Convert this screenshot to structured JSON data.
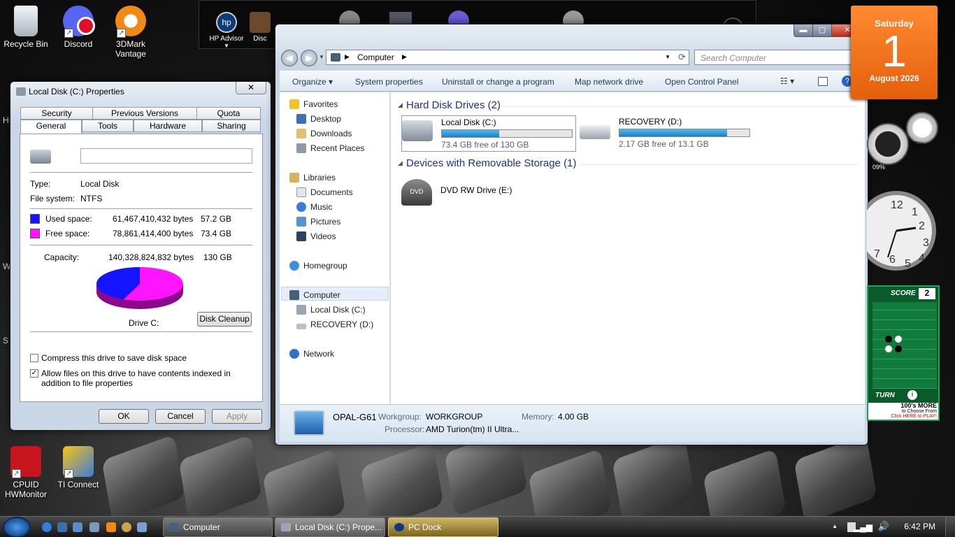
{
  "desktop": {
    "icons": [
      {
        "label": "Recycle Bin"
      },
      {
        "label": "Discord"
      },
      {
        "label": "3DMark Vantage"
      },
      {
        "label": "CPUID HWMonitor"
      },
      {
        "label": "TI Connect"
      }
    ],
    "edge_letters": [
      "H",
      "W",
      "S"
    ]
  },
  "dock": {
    "items": [
      {
        "label": "HP Advisor"
      },
      {
        "label": "Disc"
      }
    ]
  },
  "properties": {
    "title": "Local Disk (C:) Properties",
    "close": "✕",
    "tabs_row1": [
      "Security",
      "Previous Versions",
      "Quota"
    ],
    "tabs_row2": [
      "General",
      "Tools",
      "Hardware",
      "Sharing"
    ],
    "name_value": "",
    "type_label": "Type:",
    "type_value": "Local Disk",
    "fs_label": "File system:",
    "fs_value": "NTFS",
    "used_label": "Used space:",
    "used_bytes": "61,467,410,432 bytes",
    "used_size": "57.2 GB",
    "free_label": "Free space:",
    "free_bytes": "78,861,414,400 bytes",
    "free_size": "73.4 GB",
    "cap_label": "Capacity:",
    "cap_bytes": "140,328,824,832 bytes",
    "cap_size": "130 GB",
    "drive_label": "Drive C:",
    "cleanup": "Disk Cleanup",
    "compress": "Compress this drive to save disk space",
    "index": "Allow files on this drive to have contents indexed in addition to file properties",
    "ok": "OK",
    "cancel": "Cancel",
    "apply": "Apply",
    "used_color": "#1414ff",
    "free_color": "#ff14ff",
    "used_fraction": 0.438
  },
  "explorer": {
    "address": "Computer",
    "search_placeholder": "Search Computer",
    "commands": [
      "Organize ▾",
      "System properties",
      "Uninstall or change a program",
      "Map network drive",
      "Open Control Panel"
    ],
    "nav": {
      "favorites": "Favorites",
      "desktop": "Desktop",
      "downloads": "Downloads",
      "recent": "Recent Places",
      "libraries": "Libraries",
      "documents": "Documents",
      "music": "Music",
      "pictures": "Pictures",
      "videos": "Videos",
      "homegroup": "Homegroup",
      "computer": "Computer",
      "local_disk": "Local Disk (C:)",
      "recovery": "RECOVERY (D:)",
      "network": "Network"
    },
    "hdd_header": "Hard Disk Drives (2)",
    "removable_header": "Devices with Removable Storage (1)",
    "drives": [
      {
        "name": "Local Disk (C:)",
        "free": "73.4 GB free of 130 GB",
        "used_fraction": 0.44
      },
      {
        "name": "RECOVERY (D:)",
        "free": "2.17 GB free of 13.1 GB",
        "used_fraction": 0.83
      }
    ],
    "dvd": {
      "name": "DVD RW Drive (E:)",
      "badge": "DVD"
    },
    "details": {
      "computer_name": "OPAL-G61",
      "workgroup_label": "Workgroup:",
      "workgroup": "WORKGROUP",
      "memory_label": "Memory:",
      "memory": "4.00 GB",
      "processor_label": "Processor:",
      "processor": "AMD Turion(tm) II Ultra..."
    }
  },
  "gadgets": {
    "calendar": {
      "day": "Saturday",
      "date": "1",
      "month_year": "August 2026"
    },
    "meter": {
      "cpu": "09%",
      "ram": "25%"
    },
    "game": {
      "score_label": "SCORE",
      "score": "2",
      "turn": "TURN",
      "promo1": "100's MORE",
      "promo2": "to Choose From",
      "promo3": "Click HERE to PLAY!"
    }
  },
  "taskbar": {
    "buttons": [
      "Computer",
      "Local Disk (C:) Prope...",
      "PC Dock"
    ],
    "time": "6:42 PM"
  }
}
